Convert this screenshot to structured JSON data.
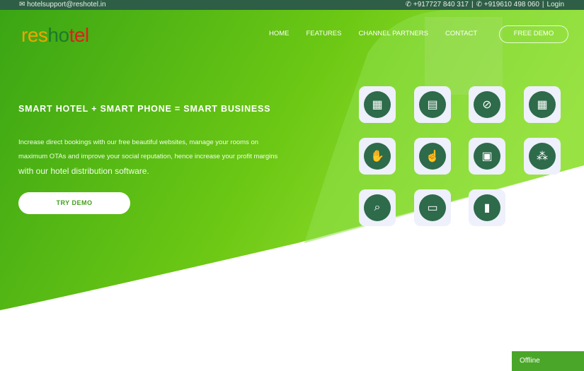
{
  "topbar": {
    "email": "hotelsupport@reshotel.in",
    "phone1": "+917727 840 317",
    "phone2": "+919610 498 060",
    "login": "Login"
  },
  "logo": {
    "part1": "res",
    "part2": "ho",
    "part3": "tel"
  },
  "nav": {
    "items": [
      "HOME",
      "FEATURES",
      "CHANNEL PARTNERS",
      "CONTACT"
    ],
    "cta": "FREE DEMO"
  },
  "hero": {
    "tagline": "SMART HOTEL + SMART PHONE = SMART BUSINESS",
    "desc_small": "Increase direct bookings with our free beautiful websites, manage your rooms on maximum OTAs and improve your social reputation, hence increase your profit margins ",
    "desc_big": "with our hotel distribution software.",
    "button": "TRY DEMO"
  },
  "features": [
    {
      "icon": "calendar-19-icon",
      "glyph": "▦"
    },
    {
      "icon": "booking-book-icon",
      "glyph": "▤"
    },
    {
      "icon": "no-commission-icon",
      "glyph": "⊘"
    },
    {
      "icon": "calendar-grid-icon",
      "glyph": "▦"
    },
    {
      "icon": "payment-hand-icon",
      "glyph": "✋"
    },
    {
      "icon": "mobile-tap-icon",
      "glyph": "☝"
    },
    {
      "icon": "gallery-icon",
      "glyph": "▣"
    },
    {
      "icon": "network-people-icon",
      "glyph": "⁂"
    },
    {
      "icon": "document-search-icon",
      "glyph": "⌕"
    },
    {
      "icon": "monitor-hotel-icon",
      "glyph": "▭"
    },
    {
      "icon": "growth-chart-icon",
      "glyph": "▮"
    }
  ],
  "chat": {
    "status": "Offline"
  },
  "colors": {
    "topbar": "#2e5e45",
    "green": "#4aa629",
    "icon_bg": "#2d6b4a"
  }
}
